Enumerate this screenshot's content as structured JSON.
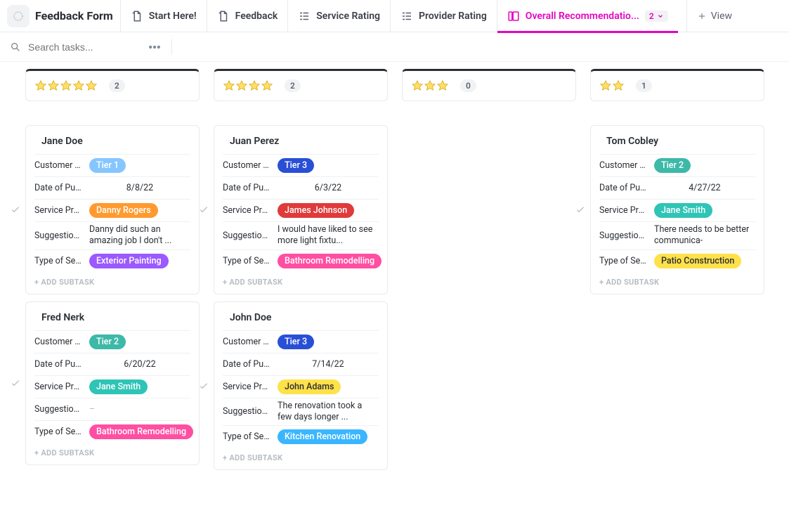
{
  "header": {
    "space_title": "Feedback Form",
    "tabs": [
      {
        "label": "Start Here!"
      },
      {
        "label": "Feedback"
      },
      {
        "label": "Service Rating"
      },
      {
        "label": "Provider Rating"
      },
      {
        "label": "Overall Recommendatio...",
        "active": true,
        "count": "2"
      }
    ],
    "view_button": "View"
  },
  "search": {
    "placeholder": "Search tasks..."
  },
  "field_labels": {
    "customer_tier": "Customer T...",
    "date_of_purchase": "Date of Pur...",
    "service_provider": "Service Pro...",
    "suggestions": "Suggestion...",
    "type_of_service": "Type of Ser..."
  },
  "add_subtask_label": "+ ADD SUBTASK",
  "columns": [
    {
      "stars": 5,
      "count": "2",
      "cards": [
        {
          "name": "Jane Doe",
          "tier": {
            "label": "Tier 1",
            "class": "tier1"
          },
          "date": "8/8/22",
          "provider": {
            "label": "Danny Rogers",
            "class": "provider-orange"
          },
          "suggestion": "Danny did such an amazing job I don't ...",
          "service": {
            "label": "Exterior Painting",
            "class": "svc-purple"
          }
        },
        {
          "name": "Fred Nerk",
          "tier": {
            "label": "Tier 2",
            "class": "tier2"
          },
          "date": "6/20/22",
          "provider": {
            "label": "Jane Smith",
            "class": "provider-teal"
          },
          "suggestion": "",
          "service": {
            "label": "Bathroom Remodelling",
            "class": "svc-pink"
          }
        }
      ]
    },
    {
      "stars": 4,
      "count": "2",
      "cards": [
        {
          "name": "Juan Perez",
          "tier": {
            "label": "Tier 3",
            "class": "tier3"
          },
          "date": "6/3/22",
          "provider": {
            "label": "James Johnson",
            "class": "provider-red"
          },
          "suggestion": "I would have liked to see more light fixtu...",
          "service": {
            "label": "Bathroom Remodelling",
            "class": "svc-pink"
          }
        },
        {
          "name": "John Doe",
          "tier": {
            "label": "Tier 3",
            "class": "tier3"
          },
          "date": "7/14/22",
          "provider": {
            "label": "John Adams",
            "class": "provider-yellow"
          },
          "suggestion": "The renovation took a few days longer ...",
          "service": {
            "label": "Kitchen Renovation",
            "class": "svc-blue"
          }
        }
      ]
    },
    {
      "stars": 3,
      "count": "0",
      "cards": []
    },
    {
      "stars": 2,
      "count": "1",
      "cards": [
        {
          "name": "Tom Cobley",
          "tier": {
            "label": "Tier 2",
            "class": "tier2"
          },
          "date": "4/27/22",
          "provider": {
            "label": "Jane Smith",
            "class": "provider-teal"
          },
          "suggestion": "There needs to be better communica-",
          "service": {
            "label": "Patio Construction",
            "class": "svc-yellow"
          }
        }
      ]
    }
  ]
}
